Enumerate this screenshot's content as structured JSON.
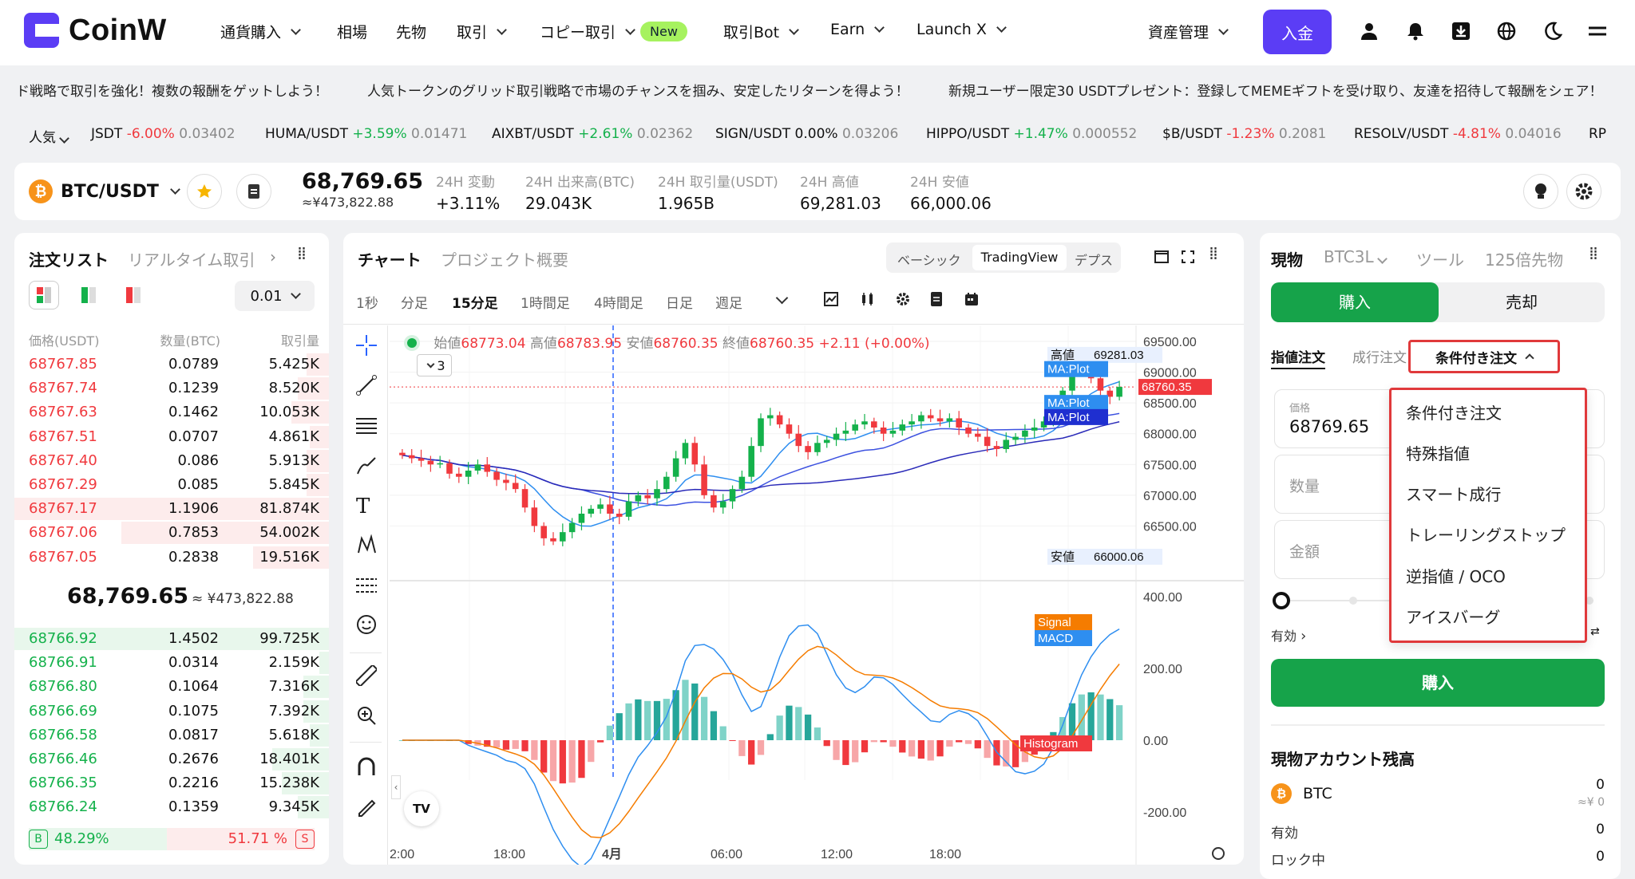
{
  "header": {
    "brand": "CoinW",
    "nav": [
      {
        "label": "通貨購入",
        "dropdown": true
      },
      {
        "label": "相場",
        "dropdown": false
      },
      {
        "label": "先物",
        "dropdown": false
      },
      {
        "label": "取引",
        "dropdown": true
      },
      {
        "label": "コピー取引",
        "dropdown": true
      },
      {
        "label": "取引Bot",
        "dropdown": true
      },
      {
        "label": "Earn",
        "dropdown": true
      },
      {
        "label": "Launch X",
        "dropdown": true
      }
    ],
    "new_badge": "New",
    "asset_mgmt": "資産管理",
    "deposit": "入金",
    "icons": [
      "user-icon",
      "bell-icon",
      "download-icon",
      "globe-icon",
      "moon-icon",
      "menu-icon"
    ]
  },
  "banner": [
    "ド戦略で取引を強化！複数の報酬をゲットしよう！",
    "人気トークンのグリッド取引戦略で市場のチャンスを掴み、安定したリターンを得よう！",
    "新規ユーザー限定30 USDTプレゼント：登録してMEMEギフトを受け取り、友達を招待して報酬をシェア！"
  ],
  "ticker": {
    "filter": "人気",
    "items": [
      {
        "pair": "JSDT",
        "change": "-6.00%",
        "price": "0.03402",
        "dir": "dn"
      },
      {
        "pair": "HUMA/USDT",
        "change": "+3.59%",
        "price": "0.01471",
        "dir": "up"
      },
      {
        "pair": "AIXBT/USDT",
        "change": "+2.61%",
        "price": "0.02362",
        "dir": "up"
      },
      {
        "pair": "SIGN/USDT",
        "change": "0.00%",
        "price": "0.03206",
        "dir": "flat"
      },
      {
        "pair": "HIPPO/USDT",
        "change": "+1.47%",
        "price": "0.000552",
        "dir": "up"
      },
      {
        "pair": "$B/USDT",
        "change": "-1.23%",
        "price": "0.2081",
        "dir": "dn"
      },
      {
        "pair": "RESOLV/USDT",
        "change": "-4.81%",
        "price": "0.04016",
        "dir": "dn"
      },
      {
        "pair": "RP",
        "change": "",
        "price": "",
        "dir": "flat"
      }
    ]
  },
  "pair": {
    "symbol": "BTC/USDT",
    "coin_glyph": "₿",
    "price": "68,769.65",
    "price_jpy": "≈¥473,822.88",
    "stats": [
      {
        "label": "24H 変動",
        "value": "+3.11%",
        "dir": "up"
      },
      {
        "label": "24H 出来高(BTC)",
        "value": "29.043K",
        "dir": "flat"
      },
      {
        "label": "24H 取引量(USDT)",
        "value": "1.965B",
        "dir": "flat"
      },
      {
        "label": "24H 高値",
        "value": "69,281.03",
        "dir": "flat"
      },
      {
        "label": "24H 安値",
        "value": "66,000.06",
        "dir": "flat"
      }
    ]
  },
  "orderbook": {
    "tabs": [
      "注文リスト",
      "リアルタイム取引"
    ],
    "precision": "0.01",
    "headers": [
      "価格(USDT)",
      "数量(BTC)",
      "取引量"
    ],
    "asks": [
      {
        "price": "68767.85",
        "qty": "0.0789",
        "total": "5.425K",
        "depth": 0.07
      },
      {
        "price": "68767.74",
        "qty": "0.1239",
        "total": "8.520K",
        "depth": 0.1
      },
      {
        "price": "68767.63",
        "qty": "0.1462",
        "total": "10.053K",
        "depth": 0.12
      },
      {
        "price": "68767.51",
        "qty": "0.0707",
        "total": "4.861K",
        "depth": 0.06
      },
      {
        "price": "68767.40",
        "qty": "0.086",
        "total": "5.913K",
        "depth": 0.07
      },
      {
        "price": "68767.29",
        "qty": "0.085",
        "total": "5.845K",
        "depth": 0.07
      },
      {
        "price": "68767.17",
        "qty": "1.1906",
        "total": "81.874K",
        "depth": 1.0
      },
      {
        "price": "68767.06",
        "qty": "0.7853",
        "total": "54.002K",
        "depth": 0.66
      },
      {
        "price": "68767.05",
        "qty": "0.2838",
        "total": "19.516K",
        "depth": 0.24
      }
    ],
    "last_price": "68,769.65",
    "last_price_jpy": "≈ ¥473,822.88",
    "bids": [
      {
        "price": "68766.92",
        "qty": "1.4502",
        "total": "99.725K",
        "depth": 1.0
      },
      {
        "price": "68766.91",
        "qty": "0.0314",
        "total": "2.159K",
        "depth": 0.03
      },
      {
        "price": "68766.80",
        "qty": "0.1064",
        "total": "7.316K",
        "depth": 0.08
      },
      {
        "price": "68766.69",
        "qty": "0.1075",
        "total": "7.392K",
        "depth": 0.08
      },
      {
        "price": "68766.58",
        "qty": "0.0817",
        "total": "5.618K",
        "depth": 0.06
      },
      {
        "price": "68766.46",
        "qty": "0.2676",
        "total": "18.401K",
        "depth": 0.18
      },
      {
        "price": "68766.35",
        "qty": "0.2216",
        "total": "15.238K",
        "depth": 0.15
      },
      {
        "price": "68766.24",
        "qty": "0.1359",
        "total": "9.345K",
        "depth": 0.1
      }
    ],
    "buy_ratio_label": "B",
    "buy_ratio": "48.29%",
    "sell_ratio": "51.71 %",
    "sell_ratio_label": "S",
    "buy_ratio_value": 0.4829
  },
  "chart": {
    "tabs": [
      "チャート",
      "プロジェクト概要"
    ],
    "views": [
      "ベーシック",
      "TradingView",
      "デプス"
    ],
    "intervals": [
      "1秒",
      "分足",
      "15分足",
      "1時間足",
      "4時間足",
      "日足",
      "週足"
    ],
    "active_interval": "15分足",
    "ohlc": {
      "o_label": "始値",
      "o": "68773.04",
      "h_label": "高値",
      "h": "68783.95",
      "l_label": "安値",
      "l": "68760.35",
      "c_label": "終値",
      "c": "68760.35",
      "chg": "+2.11 (+0.00%)"
    },
    "collapse_count": "3",
    "labels": {
      "high": "高値",
      "high_val": "69281.03",
      "low": "安値",
      "low_val": "66000.06",
      "last": "68760.35",
      "ma": "MA:Plot",
      "signal": "Signal",
      "macd": "MACD",
      "hist": "Histogram"
    },
    "xticks": [
      "2:00",
      "18:00",
      "4月",
      "06:00",
      "12:00",
      "18:00"
    ],
    "logo": "TV"
  },
  "chart_data": [
    {
      "type": "candlestick",
      "title": "",
      "yticks": [
        "69500.00",
        "69000.00",
        "68500.00",
        "68000.00",
        "67500.00",
        "67000.00",
        "66500.00"
      ],
      "ylim": [
        66000,
        69500
      ],
      "closes": [
        67650,
        67600,
        67560,
        67500,
        67520,
        67350,
        67300,
        67400,
        67500,
        67380,
        67250,
        67200,
        67100,
        66800,
        66500,
        66300,
        66250,
        66400,
        66550,
        66700,
        66780,
        66850,
        66700,
        66650,
        66900,
        67000,
        66950,
        67100,
        67300,
        67600,
        67850,
        67500,
        67000,
        66800,
        66900,
        67100,
        67300,
        67800,
        68250,
        68300,
        68150,
        68000,
        67800,
        67700,
        67850,
        67900,
        68000,
        68050,
        68150,
        68200,
        68100,
        68000,
        68050,
        68150,
        68200,
        68300,
        68250,
        68200,
        68250,
        68100,
        68000,
        67950,
        67800,
        67750,
        67900,
        67950,
        68050,
        68100,
        68200,
        68400,
        68700,
        69150,
        69100,
        68900,
        68700,
        68600,
        68760
      ]
    },
    {
      "type": "bar",
      "title": "",
      "yticks": [
        "400.00",
        "200.00",
        "0.00",
        "-200.00"
      ],
      "ylim": [
        -300,
        400
      ]
    }
  ],
  "trade": {
    "tabs": [
      "現物",
      "BTC3L",
      "ツール",
      "125倍先物"
    ],
    "buy": "購入",
    "sell": "売却",
    "order_tabs": [
      "指値注文",
      "成行注文",
      "条件付き注文"
    ],
    "price_label": "価格",
    "price": "68769.65",
    "qty_label": "数量",
    "amount_label": "金額",
    "valid": "有効",
    "submit": "購入",
    "balance_title": "現物アカウント残高",
    "coin": "BTC",
    "coin_bal": "0",
    "coin_jpy": "≈¥ 0",
    "available_label": "有効",
    "available": "0",
    "locked_label": "ロック中",
    "locked": "0"
  },
  "dropdown": {
    "items": [
      "条件付き注文",
      "特殊指値",
      "スマート成行",
      "トレーリングストップ",
      "逆指値 / OCO",
      "アイスバーグ"
    ]
  }
}
